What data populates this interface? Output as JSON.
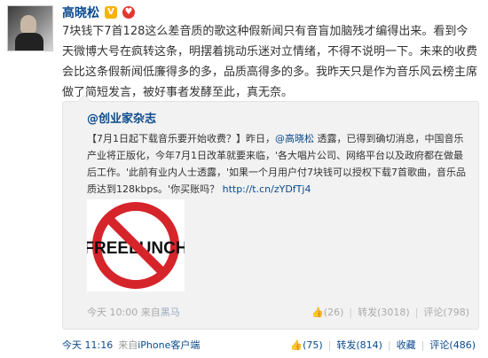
{
  "post": {
    "username": "高晓松",
    "text": "7块钱下7首128这么差音质的歌这种假新闻只有音盲加脑残才编得出来。看到今天微博大号在疯转这条，明摆着挑动乐迷对立情绪，不得不说明一下。未来的收费会比这条假新闻低廉得多的多，品质高得多的多。我昨天只是作为音乐风云榜主席做了简短发言，被好事者发酵至此，真无奈。"
  },
  "repost": {
    "author": "@创业家杂志",
    "text_a": "【7月1日起下载音乐要开始收费？】昨日，",
    "mention": "@高晓松",
    "text_b": " 透露，已得到确切消息，中国音乐产业将正版化，今年7月1日改革就要来临，'各大唱片公司、网络平台以及政府都在做最后工作。'此前有业内人士透露，'如果一个月用户付7块钱可以授权下载7首歌曲，音乐品质达到128kbps。'你买账吗？",
    "link": "http://t.cn/zYDfTj4",
    "thumb_text": "FREELUNCH",
    "time": "今天 10:00",
    "source_prefix": "来自",
    "source": "黑马",
    "like_count": "(26)",
    "repost": "转发(3018)",
    "comment": "评论(798)"
  },
  "meta": {
    "time": "今天 11:16",
    "source_prefix": "来自",
    "source": "iPhone客户端",
    "like_count": "(75)",
    "repost": "转发(814)",
    "favorite": "收藏",
    "comment": "评论(486)"
  },
  "colors": {
    "link": "#0a4a8c",
    "repost_bg": "#f2f2f2",
    "no_sign_red": "#d6242b"
  },
  "icons": {
    "vip": "vip-badge-icon",
    "heart": "heart-icon",
    "like": "thumbs-up-icon"
  }
}
